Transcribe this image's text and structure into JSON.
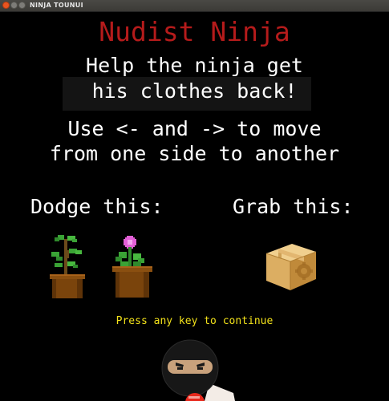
{
  "window": {
    "title": "NINJA TOUNUI"
  },
  "screen": {
    "game_title": "Nudist Ninja",
    "subtitle_line1": "Help the ninja get",
    "subtitle_line2": "his clothes back!",
    "instructions_line1": "Use <- and -> to move",
    "instructions_line2": "from one side to another",
    "dodge_label": "Dodge this:",
    "grab_label": "Grab this:",
    "continue_prompt": "Press any key to continue"
  },
  "colors": {
    "background": "#000000",
    "title_red": "#b51b1b",
    "text_white": "#ffffff",
    "prompt_yellow": "#f2e11a"
  },
  "icons": {
    "dodge_items": [
      "potted-plant-icon",
      "flower-pot-icon"
    ],
    "grab_items": [
      "package-box-icon"
    ],
    "player": "ninja-head-icon"
  }
}
